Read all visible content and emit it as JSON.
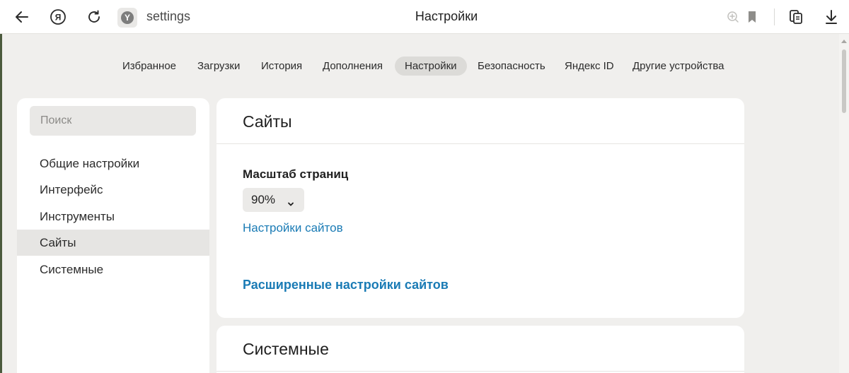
{
  "browser": {
    "address": "settings",
    "page_title": "Настройки",
    "site_badge": "Y",
    "yandex_button": "Я"
  },
  "tabs": [
    {
      "label": "Избранное"
    },
    {
      "label": "Загрузки"
    },
    {
      "label": "История"
    },
    {
      "label": "Дополнения"
    },
    {
      "label": "Настройки",
      "active": true
    },
    {
      "label": "Безопасность"
    },
    {
      "label": "Яндекс ID"
    },
    {
      "label": "Другие устройства"
    }
  ],
  "sidebar": {
    "search_placeholder": "Поиск",
    "items": [
      {
        "label": "Общие настройки"
      },
      {
        "label": "Интерфейс"
      },
      {
        "label": "Инструменты"
      },
      {
        "label": "Сайты",
        "active": true
      },
      {
        "label": "Системные"
      }
    ]
  },
  "sites_card": {
    "title": "Сайты",
    "zoom_label": "Масштаб страниц",
    "zoom_value": "90%",
    "site_settings_link": "Настройки сайтов",
    "advanced_link": "Расширенные настройки сайтов"
  },
  "system_card": {
    "title": "Системные"
  },
  "colors": {
    "link": "#1a7bb5",
    "page_bg": "#f0efed",
    "active_tab_bg": "#dcdbd8"
  },
  "icons": [
    "back-arrow-icon",
    "yandex-icon",
    "reload-icon",
    "site-icon",
    "add-bookmark-icon",
    "bookmark-icon",
    "collections-icon",
    "download-icon"
  ]
}
